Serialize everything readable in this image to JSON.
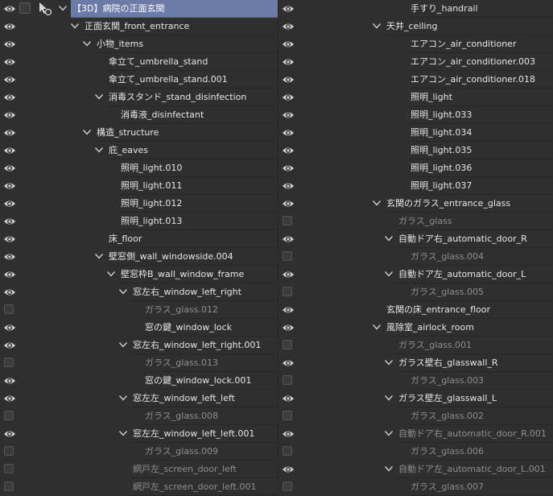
{
  "left_panel": [
    {
      "label": "【3D】病院の正面玄関",
      "depth": 0,
      "expand": true,
      "visible": true,
      "highlight": true,
      "root": true
    },
    {
      "label": "正面玄関_front_entrance",
      "depth": 1,
      "expand": true,
      "visible": true
    },
    {
      "label": "小物_items",
      "depth": 2,
      "expand": true,
      "visible": true
    },
    {
      "label": "傘立て_umbrella_stand",
      "depth": 3,
      "expand": false,
      "visible": true
    },
    {
      "label": "傘立て_umbrella_stand.001",
      "depth": 3,
      "expand": false,
      "visible": true
    },
    {
      "label": "消毒スタンド_stand_disinfection",
      "depth": 3,
      "expand": true,
      "visible": true
    },
    {
      "label": "消毒液_disinfectant",
      "depth": 4,
      "expand": false,
      "visible": true
    },
    {
      "label": "構造_structure",
      "depth": 2,
      "expand": true,
      "visible": true
    },
    {
      "label": "庇_eaves",
      "depth": 3,
      "expand": true,
      "visible": true
    },
    {
      "label": "照明_light.010",
      "depth": 4,
      "expand": false,
      "visible": true
    },
    {
      "label": "照明_light.011",
      "depth": 4,
      "expand": false,
      "visible": true
    },
    {
      "label": "照明_light.012",
      "depth": 4,
      "expand": false,
      "visible": true
    },
    {
      "label": "照明_light.013",
      "depth": 4,
      "expand": false,
      "visible": true
    },
    {
      "label": "床_floor",
      "depth": 3,
      "expand": false,
      "visible": true
    },
    {
      "label": "壁窓側_wall_windowside.004",
      "depth": 3,
      "expand": true,
      "visible": true
    },
    {
      "label": "壁窓枠B_wall_window_frame",
      "depth": 4,
      "expand": true,
      "visible": true
    },
    {
      "label": "窓左右_window_left_right",
      "depth": 5,
      "expand": true,
      "visible": true
    },
    {
      "label": "ガラス_glass.012",
      "depth": 6,
      "expand": false,
      "visible": false
    },
    {
      "label": "窓の鍵_window_lock",
      "depth": 6,
      "expand": false,
      "visible": true
    },
    {
      "label": "窓左右_window_left_right.001",
      "depth": 5,
      "expand": true,
      "visible": true
    },
    {
      "label": "ガラス_glass.013",
      "depth": 6,
      "expand": false,
      "visible": false
    },
    {
      "label": "窓の鍵_window_lock.001",
      "depth": 6,
      "expand": false,
      "visible": true
    },
    {
      "label": "窓左左_window_left_left",
      "depth": 5,
      "expand": true,
      "visible": true
    },
    {
      "label": "ガラス_glass.008",
      "depth": 6,
      "expand": false,
      "visible": false
    },
    {
      "label": "窓左左_window_left_left.001",
      "depth": 5,
      "expand": true,
      "visible": true
    },
    {
      "label": "ガラス_glass.009",
      "depth": 6,
      "expand": false,
      "visible": false
    },
    {
      "label": "網戸左_screen_door_left",
      "depth": 5,
      "expand": false,
      "visible": false
    },
    {
      "label": "網戸左_screen_door_left.001",
      "depth": 5,
      "expand": false,
      "visible": false
    }
  ],
  "right_panel": [
    {
      "label": "手すり_handrail",
      "depth": 2,
      "expand": false,
      "visible": true
    },
    {
      "label": "天井_ceiling",
      "depth": 0,
      "expand": true,
      "visible": true
    },
    {
      "label": "エアコン_air_conditioner",
      "depth": 2,
      "expand": false,
      "visible": true
    },
    {
      "label": "エアコン_air_conditioner.003",
      "depth": 2,
      "expand": false,
      "visible": true
    },
    {
      "label": "エアコン_air_conditioner.018",
      "depth": 2,
      "expand": false,
      "visible": true
    },
    {
      "label": "照明_light",
      "depth": 2,
      "expand": false,
      "visible": true
    },
    {
      "label": "照明_light.033",
      "depth": 2,
      "expand": false,
      "visible": true
    },
    {
      "label": "照明_light.034",
      "depth": 2,
      "expand": false,
      "visible": true
    },
    {
      "label": "照明_light.035",
      "depth": 2,
      "expand": false,
      "visible": true
    },
    {
      "label": "照明_light.036",
      "depth": 2,
      "expand": false,
      "visible": true
    },
    {
      "label": "照明_light.037",
      "depth": 2,
      "expand": false,
      "visible": true
    },
    {
      "label": "玄関のガラス_entrance_glass",
      "depth": 0,
      "expand": true,
      "visible": true
    },
    {
      "label": "ガラス_glass",
      "depth": 1,
      "expand": false,
      "visible": false
    },
    {
      "label": "自動ドア右_automatic_door_R",
      "depth": 1,
      "expand": true,
      "visible": true
    },
    {
      "label": "ガラス_glass.004",
      "depth": 2,
      "expand": false,
      "visible": false
    },
    {
      "label": "自動ドア左_automatic_door_L",
      "depth": 1,
      "expand": true,
      "visible": true
    },
    {
      "label": "ガラス_glass.005",
      "depth": 2,
      "expand": false,
      "visible": false
    },
    {
      "label": "玄関の床_entrance_floor",
      "depth": 0,
      "expand": false,
      "visible": true,
      "noarrow": true
    },
    {
      "label": "風除室_airlock_room",
      "depth": 0,
      "expand": true,
      "visible": true
    },
    {
      "label": "ガラス_glass.001",
      "depth": 1,
      "expand": false,
      "visible": false
    },
    {
      "label": "ガラス壁右_glasswall_R",
      "depth": 1,
      "expand": true,
      "visible": true
    },
    {
      "label": "ガラス_glass.003",
      "depth": 2,
      "expand": false,
      "visible": false
    },
    {
      "label": "ガラス壁左_glasswall_L",
      "depth": 1,
      "expand": true,
      "visible": true
    },
    {
      "label": "ガラス_glass.002",
      "depth": 2,
      "expand": false,
      "visible": false
    },
    {
      "label": "自動ドア右_automatic_door_R.001",
      "depth": 1,
      "expand": true,
      "visible": true,
      "dim": true
    },
    {
      "label": "ガラス_glass.006",
      "depth": 2,
      "expand": false,
      "visible": false
    },
    {
      "label": "自動ドア左_automatic_door_L.001",
      "depth": 1,
      "expand": true,
      "visible": true,
      "dim": true
    },
    {
      "label": "ガラス_glass.007",
      "depth": 2,
      "expand": false,
      "visible": false
    }
  ],
  "colors": {
    "background": "#2f2f2f",
    "highlight": "#6c7aa8",
    "text": "#e6e6e6",
    "dim_text": "#8e8e8e"
  },
  "icons": {
    "visible": "eye-icon",
    "hidden": "empty-box",
    "expand": "chevron-down-icon",
    "cursor": "cursor-icon"
  }
}
